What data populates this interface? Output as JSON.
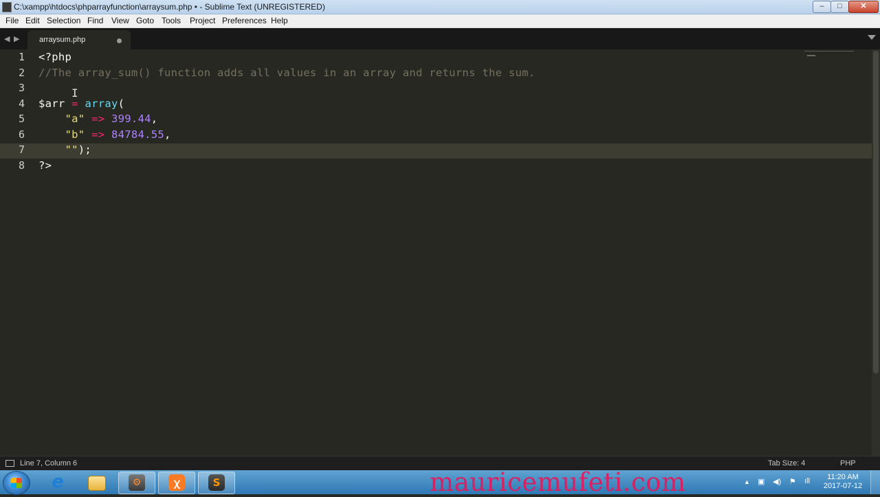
{
  "window": {
    "title": "C:\\xampp\\htdocs\\phparrayfunction\\arraysum.php • - Sublime Text (UNREGISTERED)",
    "min_label": "–",
    "max_label": "□",
    "close_label": "✕"
  },
  "menu": [
    "File",
    "Edit",
    "Selection",
    "Find",
    "View",
    "Goto",
    "Tools",
    "Project",
    "Preferences",
    "Help"
  ],
  "tabs": [
    {
      "label": "arraysum.php",
      "dirty": true
    }
  ],
  "nav": {
    "back": "◀",
    "forward": "▶"
  },
  "editor": {
    "line_numbers": [
      "1",
      "2",
      "3",
      "4",
      "5",
      "6",
      "7",
      "8"
    ],
    "current_line": 7,
    "lines": [
      [
        {
          "t": "<?php",
          "c": "plain"
        }
      ],
      [
        {
          "t": "//The array_sum() function adds all values in an array and returns the sum.",
          "c": "comment"
        }
      ],
      [],
      [
        {
          "t": "$arr ",
          "c": "plain"
        },
        {
          "t": "=",
          "c": "op"
        },
        {
          "t": " ",
          "c": "plain"
        },
        {
          "t": "array",
          "c": "func"
        },
        {
          "t": "(",
          "c": "plain"
        }
      ],
      [
        {
          "t": "    ",
          "c": "plain"
        },
        {
          "t": "\"a\"",
          "c": "str"
        },
        {
          "t": " ",
          "c": "plain"
        },
        {
          "t": "=>",
          "c": "op"
        },
        {
          "t": " ",
          "c": "plain"
        },
        {
          "t": "399.44",
          "c": "num"
        },
        {
          "t": ",",
          "c": "plain"
        }
      ],
      [
        {
          "t": "    ",
          "c": "plain"
        },
        {
          "t": "\"b\"",
          "c": "str"
        },
        {
          "t": " ",
          "c": "plain"
        },
        {
          "t": "=>",
          "c": "op"
        },
        {
          "t": " ",
          "c": "plain"
        },
        {
          "t": "84784.55",
          "c": "num"
        },
        {
          "t": ",",
          "c": "plain"
        }
      ],
      [
        {
          "t": "    ",
          "c": "plain"
        },
        {
          "t": "\"\"",
          "c": "str"
        },
        {
          "t": ");",
          "c": "plain"
        }
      ],
      [
        {
          "t": "?>",
          "c": "plain"
        }
      ]
    ],
    "cursor_glyph": "I"
  },
  "status": {
    "position": "Line 7, Column 6",
    "tab_size": "Tab Size: 4",
    "syntax": "PHP"
  },
  "taskbar": {
    "apps": [
      {
        "name": "internet-explorer",
        "glyph": "e"
      },
      {
        "name": "file-explorer",
        "glyph": ""
      },
      {
        "name": "tool",
        "glyph": "⚙"
      },
      {
        "name": "xampp",
        "glyph": "ꭓ"
      },
      {
        "name": "sublime-text",
        "glyph": "S"
      }
    ],
    "watermark": "mauricemufeti.com",
    "clock_time": "11:20 AM",
    "clock_date": "2017-07-12",
    "tray": [
      "▲",
      "▣",
      "◀)",
      "⚑",
      "ıll"
    ]
  },
  "colors": {
    "background": "#272822",
    "comment": "#75715e",
    "keyword": "#f92672",
    "function": "#66d9ef",
    "string": "#e6db74",
    "number": "#ae81ff",
    "watermark": "#e4195c"
  }
}
